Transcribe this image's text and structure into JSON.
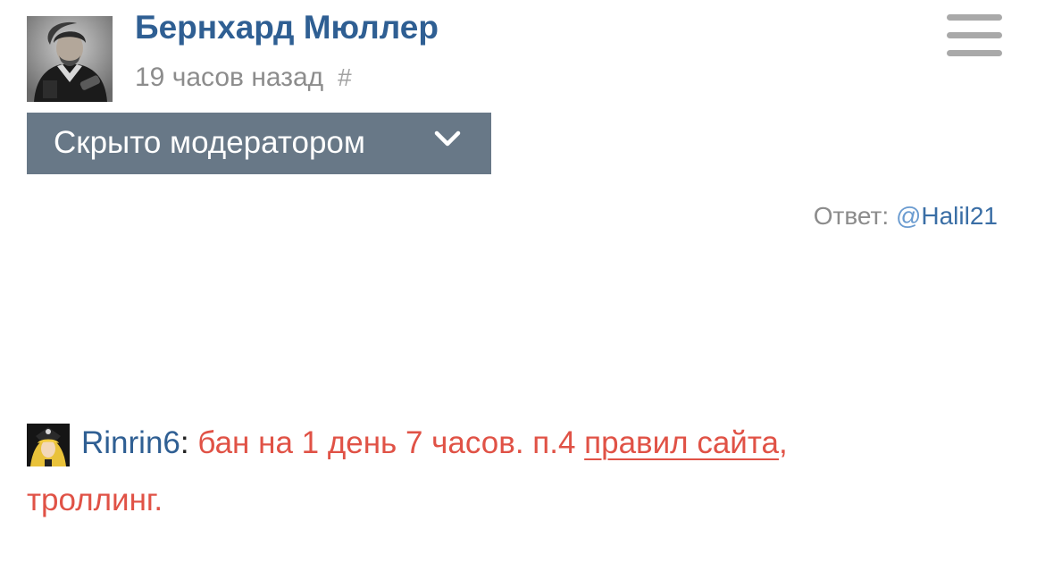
{
  "comment": {
    "author": "Бернхард Мюллер",
    "time": "19 часов назад",
    "permalink": "#",
    "hidden_label": "Скрыто модератором",
    "reply_prefix": "Ответ: ",
    "reply_at": "@",
    "reply_user": "Halil21"
  },
  "moderation": {
    "moderator": "Rinrin6",
    "colon": ":",
    "text_before": " бан на 1 день 7 часов. п.4 ",
    "rules_link": "правил сайта",
    "comma": ",",
    "text_after": "троллинг."
  },
  "icons": {
    "menu": "hamburger-menu-icon",
    "expand": "chevron-down-icon"
  },
  "colors": {
    "link_blue": "#2f5f93",
    "meta_gray": "#8c8c8c",
    "hidden_bar": "#687887",
    "moderation_red": "#e05246"
  }
}
